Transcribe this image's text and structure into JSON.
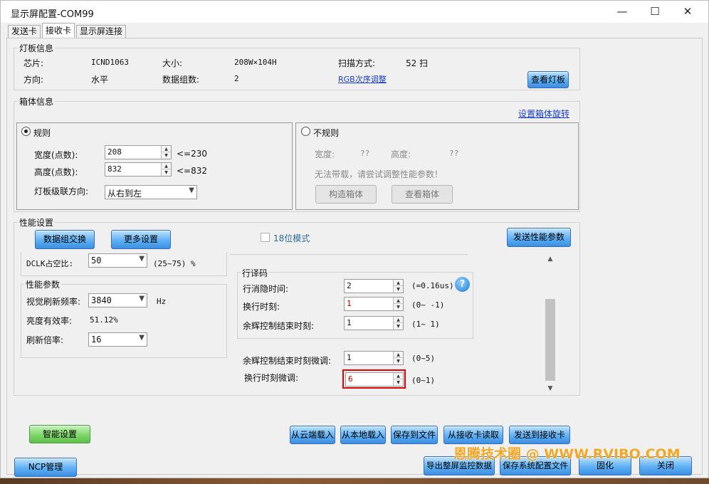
{
  "window": {
    "title": "显示屏配置-COM99",
    "minimize": "—",
    "maximize": "☐",
    "close": "✕"
  },
  "tabs": [
    "发送卡",
    "接收卡",
    "显示屏连接"
  ],
  "panel_info": {
    "legend": "灯板信息",
    "chip_label": "芯片:",
    "chip_value": "ICND1063",
    "size_label": "大小:",
    "size_value": "208W×104H",
    "scan_label": "扫描方式:",
    "scan_value": "52 扫",
    "dir_label": "方向:",
    "dir_value": "水平",
    "groups_label": "数据组数:",
    "groups_value": "2",
    "rgb_link": "RGB次序调整",
    "view_button": "查看灯板"
  },
  "cabinet": {
    "legend": "箱体信息",
    "rotate_link": "设置箱体旋转",
    "regular": {
      "label": "规则",
      "width_label": "宽度(点数):",
      "width_value": "208",
      "width_limit": "<=230",
      "height_label": "高度(点数):",
      "height_value": "832",
      "height_limit": "<=832",
      "cascade_label": "灯板级联方向:",
      "cascade_value": "从右到左"
    },
    "irregular": {
      "label": "不规则",
      "width_label": "宽度:",
      "width_value": "??",
      "height_label": "高度:",
      "height_value": "??",
      "hint": "无法带载，请尝试调整性能参数！",
      "build_button": "构造箱体",
      "view_button": "查看箱体"
    }
  },
  "performance": {
    "legend": "性能设置",
    "swap_button": "数据组交换",
    "more_button": "更多设置",
    "mode18_label": "18位模式",
    "send_button": "发送性能参数",
    "dclk_label": "DCLK占空比:",
    "dclk_value": "50",
    "dclk_range": "(25~75) %",
    "params_legend": "性能参数",
    "refresh_label": "视觉刷新频率:",
    "refresh_value": "3840",
    "refresh_unit": "Hz",
    "brightness_label": "亮度有效率:",
    "brightness_value": "51.12%",
    "multiplier_label": "刷新倍率:",
    "multiplier_value": "16",
    "row_decode_legend": "行译码",
    "blank_label": "行消隐时间:",
    "blank_value": "2",
    "blank_range": "(=0.16us)",
    "switch_label": "换行时刻:",
    "switch_value": "1",
    "switch_range": "(0~ -1)",
    "afterglow_label": "余辉控制结束时刻:",
    "afterglow_value": "1",
    "afterglow_range": "(1~ 1)",
    "afterglow_fine_label": "余辉控制结束时刻微调:",
    "afterglow_fine_value": "1",
    "afterglow_fine_range": "(0~5)",
    "switch_fine_label": "换行时刻微调:",
    "switch_fine_value": "6",
    "switch_fine_range": "(0~1)",
    "help_glyph": "?"
  },
  "footer": {
    "smart_button": "智能设置",
    "cloud_button": "从云端载入",
    "local_button": "从本地载入",
    "save_file_button": "保存到文件",
    "read_card_button": "从接收卡读取",
    "send_card_button": "发送到接收卡",
    "ncp_button": "NCP管理",
    "export_button": "导出整屏监控数据",
    "save_config_button": "保存系统配置文件",
    "solidify_button": "固化",
    "close_button": "关闭"
  },
  "watermark": "恩腾技术圈 @ WWW.RVIBO.COM",
  "colors": {
    "button_blue": "#5eb0f5",
    "button_green": "#7ed66a",
    "link": "#1a3dc8",
    "highlight_border": "#e00000",
    "watermark": "#f5a623"
  }
}
